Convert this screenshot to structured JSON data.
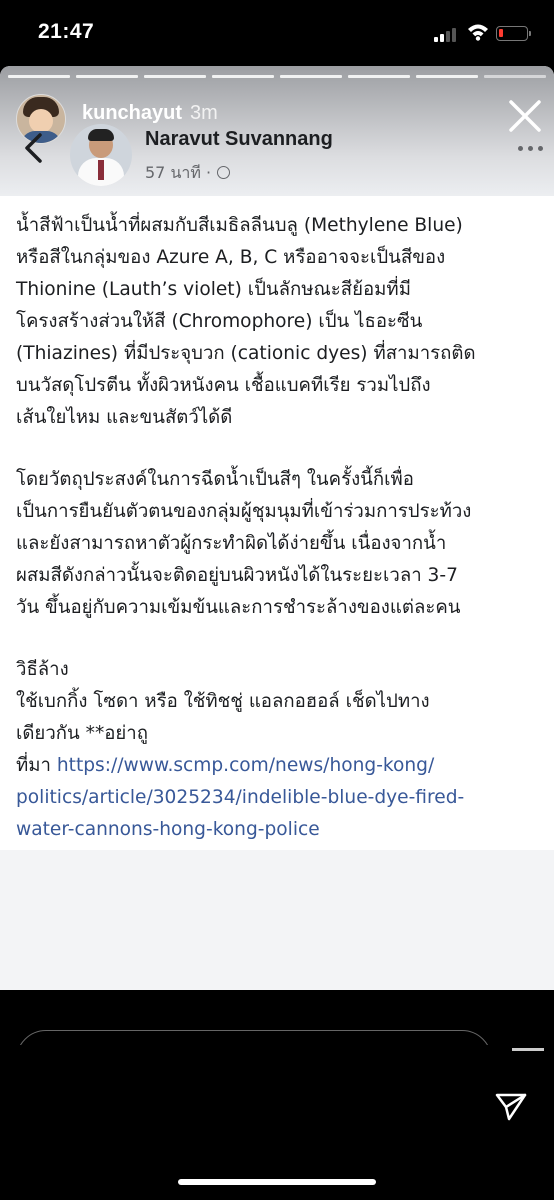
{
  "status_bar": {
    "time": "21:47"
  },
  "story": {
    "username": "kunchayut",
    "time_ago": "3m",
    "segments": 8
  },
  "post": {
    "author": "Naravut Suvannang",
    "time": "57 นาที ·",
    "paragraph1": [
      "น้ำสีฟ้าเป็นน้ำที่ผสมกับสีเมธิลลีนบลู (Methylene Blue)",
      "หรือสีในกลุ่มของ Azure A, B, C หรืออาจจะเป็นสีของ",
      "Thionine (Lauth’s violet) เป็นลักษณะสีย้อมที่มี",
      "โครงสร้างส่วนให้สี (Chromophore) เป็น ไธอะซีน",
      "(Thiazines) ที่มีประจุบวก (cationic dyes) ที่สามารถติด",
      "บนวัสดุโปรตีน ทั้งผิวหนังคน เชื้อแบคทีเรีย รวมไปถึง",
      "เส้นใยไหม และขนสัตว์ได้ดี"
    ],
    "paragraph2": [
      "โดยวัตถุประสงค์ในการฉีดน้ำเป็นสีๆ ในครั้งนี้ก็เพื่อ",
      "เป็นการยืนยันตัวตนของกลุ่มผู้ชุมนุมที่เข้าร่วมการประท้วง",
      "และยังสามารถหาตัวผู้กระทำผิดได้ง่ายขึ้น เนื่องจากน้ำ",
      "ผสมสีดังกล่าวนั้นจะติดอยู่บนผิวหนังได้ในระยะเวลา 3-7",
      "วัน ขึ้นอยู่กับความเข้มข้นและการชำระล้างของแต่ละคน"
    ],
    "paragraph3": [
      "วิธีล้าง",
      "ใช้เบกกิ้ง โซดา หรือ ใช้ทิชชู่ แอลกอฮอล์ เช็ดไปทาง",
      "เดียวกัน **อย่าถู"
    ],
    "source_label": "ที่มา ",
    "source_link": [
      "https://www.scmp.com/news/hong-kong/",
      "politics/article/3025234/indelible-blue-dye-fired-",
      "water-cannons-hong-kong-police"
    ]
  }
}
